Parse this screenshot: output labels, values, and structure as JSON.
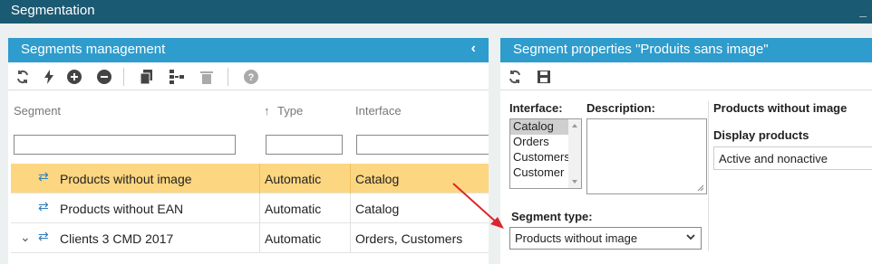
{
  "app": {
    "title": "Segmentation",
    "minimize_label": "_"
  },
  "left_panel": {
    "title": "Segments management",
    "collapse_label": "‹",
    "columns": {
      "segment": "Segment",
      "type": "Type",
      "interface": "Interface"
    },
    "rows": [
      {
        "name": "Products without image",
        "type": "Automatic",
        "interface": "Catalog",
        "selected": true
      },
      {
        "name": "Products without EAN",
        "type": "Automatic",
        "interface": "Catalog",
        "selected": false
      },
      {
        "name": "Clients 3 CMD 2017",
        "type": "Automatic",
        "interface": "Orders, Customers",
        "selected": false
      }
    ]
  },
  "right_panel": {
    "title": "Segment properties \"Produits sans image\"",
    "interface_label": "Interface:",
    "interface_options": [
      "Catalog",
      "Orders",
      "Customers",
      "Customer"
    ],
    "description_label": "Description:",
    "segment_type_label": "Segment type:",
    "segment_type_value": "Products without image",
    "side_title": "Products without image",
    "display_products_label": "Display products",
    "display_products_value": "Active and nonactive"
  },
  "colors": {
    "topbar": "#1b5a73",
    "panel_header": "#2e9ccd",
    "selected_row": "#fcd680",
    "arrow": "#d9262e"
  }
}
